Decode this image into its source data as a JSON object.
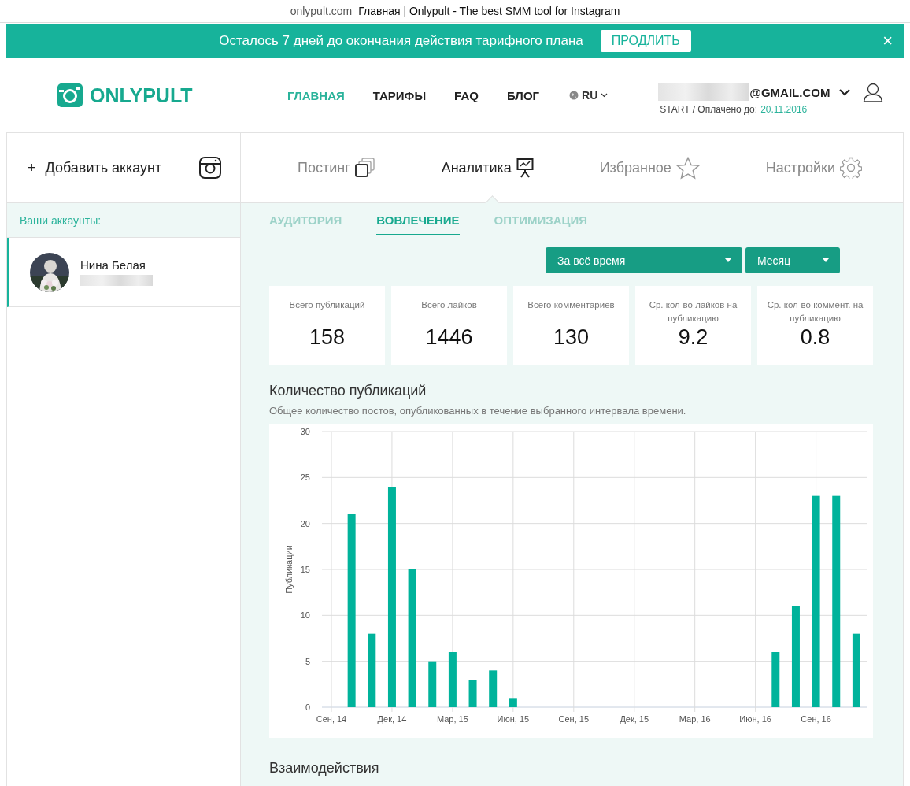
{
  "browser_title": {
    "domain": "onlypult.com",
    "title": "Главная | Onlypult - The best SMM tool for Instagram"
  },
  "banner": {
    "message": "Осталось 7 дней до окончания действия тарифного плана",
    "button": "ПРОДЛИТЬ",
    "close": "×"
  },
  "header": {
    "logo": "ONLYPULT",
    "nav": [
      {
        "label": "ГЛАВНАЯ",
        "selected": true
      },
      {
        "label": "ТАРИФЫ",
        "selected": false
      },
      {
        "label": "FAQ",
        "selected": false
      },
      {
        "label": "БЛОГ",
        "selected": false
      }
    ],
    "language": "RU",
    "account": {
      "email": "@GMAIL.COM",
      "plan": "START / Оплачено до:",
      "paid_until": "20.11.2016"
    }
  },
  "sidebar": {
    "add_icon": "+",
    "add_account": "Добавить аккаунт",
    "accounts_heading": "Ваши аккаунты:",
    "accounts": [
      {
        "name": "Нина Белая",
        "selected": true
      }
    ]
  },
  "main_tabs": [
    {
      "label": "Постинг",
      "kind": "posting",
      "selected": false
    },
    {
      "label": "Аналитика",
      "kind": "analytics",
      "selected": true
    },
    {
      "label": "Избранное",
      "kind": "favorites",
      "selected": false
    },
    {
      "label": "Настройки",
      "kind": "settings",
      "selected": false
    }
  ],
  "sub_tabs": [
    {
      "label": "АУДИТОРИЯ",
      "selected": false
    },
    {
      "label": "ВОВЛЕЧЕНИЕ",
      "selected": true
    },
    {
      "label": "ОПТИМИЗАЦИЯ",
      "selected": false
    }
  ],
  "filters": [
    {
      "value": "За всё время"
    },
    {
      "value": "Месяц"
    }
  ],
  "stats": [
    {
      "label": "Всего публикаций",
      "value": "158"
    },
    {
      "label": "Всего лайков",
      "value": "1446"
    },
    {
      "label": "Всего комментариев",
      "value": "130"
    },
    {
      "label": "Ср. кол-во лайков на публикацию",
      "value": "9.2"
    },
    {
      "label": "Ср. кол-во коммент. на публикацию",
      "value": "0.8"
    }
  ],
  "chart_section": {
    "title": "Количество публикаций",
    "description": "Общее количество постов, опубликованных в течение выбранного интервала времени.",
    "chart_data": {
      "type": "bar",
      "ylabel": "Публикации",
      "categories": [
        "Сен, 14",
        null,
        null,
        "Дек, 14",
        null,
        null,
        "Мар, 15",
        null,
        null,
        "Июн, 15",
        null,
        null,
        "Сен, 15",
        null,
        null,
        "Дек, 15",
        null,
        null,
        "Мар, 16",
        null,
        null,
        "Июн, 16",
        null,
        null,
        "Сен, 16",
        null,
        null
      ],
      "series": [
        {
          "color": "#00b39b",
          "values": [
            0,
            21,
            8,
            24,
            15,
            5,
            6,
            3,
            4,
            1,
            0,
            0,
            0,
            0,
            0,
            0,
            0,
            0,
            0,
            0,
            0,
            0,
            6,
            11,
            23,
            23,
            8
          ]
        }
      ],
      "grid": true,
      "ylim": [
        0,
        30
      ],
      "yticks": [
        0,
        5,
        10,
        15,
        20,
        25,
        30
      ]
    }
  },
  "next_section": {
    "title": "Взаимодействия"
  }
}
